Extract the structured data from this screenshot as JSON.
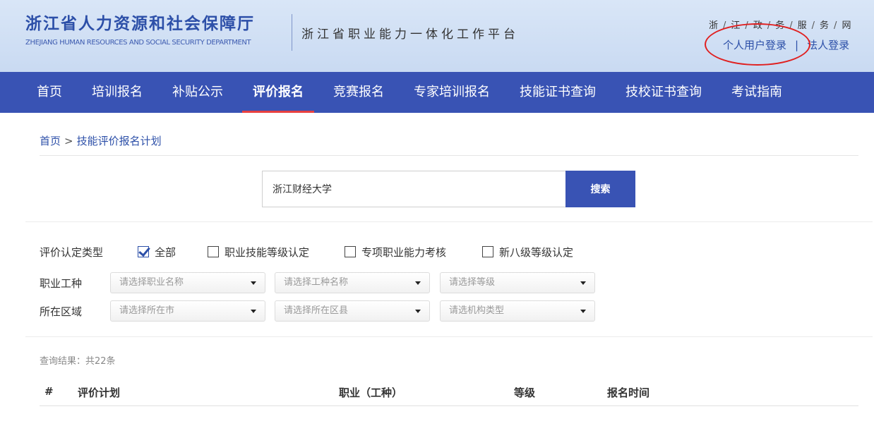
{
  "header": {
    "logo_cn": "浙江省人力资源和社会保障厅",
    "logo_en": "ZHEJIANG HUMAN RESOURCES AND SOCIAL SECURITY DEPARTMENT",
    "platform_title": "浙江省职业能力一体化工作平台",
    "gov_net_chars": [
      "浙",
      "江",
      "政",
      "务",
      "服",
      "务",
      "网"
    ],
    "personal_login": "个人用户登录",
    "separator": "|",
    "legal_login": "法人登录"
  },
  "nav": {
    "items": [
      {
        "label": "首页"
      },
      {
        "label": "培训报名"
      },
      {
        "label": "补贴公示"
      },
      {
        "label": "评价报名",
        "active": true
      },
      {
        "label": "竞赛报名"
      },
      {
        "label": "专家培训报名"
      },
      {
        "label": "技能证书查询"
      },
      {
        "label": "技校证书查询"
      },
      {
        "label": "考试指南"
      }
    ]
  },
  "breadcrumb": {
    "home": "首页",
    "sep": ">",
    "current": "技能评价报名计划"
  },
  "search": {
    "value": "浙江财经大学",
    "button": "搜索"
  },
  "filters": {
    "type_label": "评价认定类型",
    "types": [
      {
        "label": "全部",
        "checked": true
      },
      {
        "label": "职业技能等级认定",
        "checked": false
      },
      {
        "label": "专项职业能力考核",
        "checked": false
      },
      {
        "label": "新八级等级认定",
        "checked": false
      }
    ],
    "occupation_label": "职业工种",
    "occupation_selects": [
      "请选择职业名称",
      "请选择工种名称",
      "请选择等级"
    ],
    "region_label": "所在区域",
    "region_selects": [
      "请选择所在市",
      "请选择所在区县",
      "请选机构类型"
    ]
  },
  "results": {
    "count_text": "查询结果：共22条",
    "columns": [
      "#",
      "评价计划",
      "职业（工种）",
      "等级",
      "报名时间"
    ]
  },
  "colors": {
    "brand": "#3953b4",
    "header_bg": "#d9e6f7",
    "active_underline": "#e84040",
    "annotation_circle": "#e02020"
  }
}
